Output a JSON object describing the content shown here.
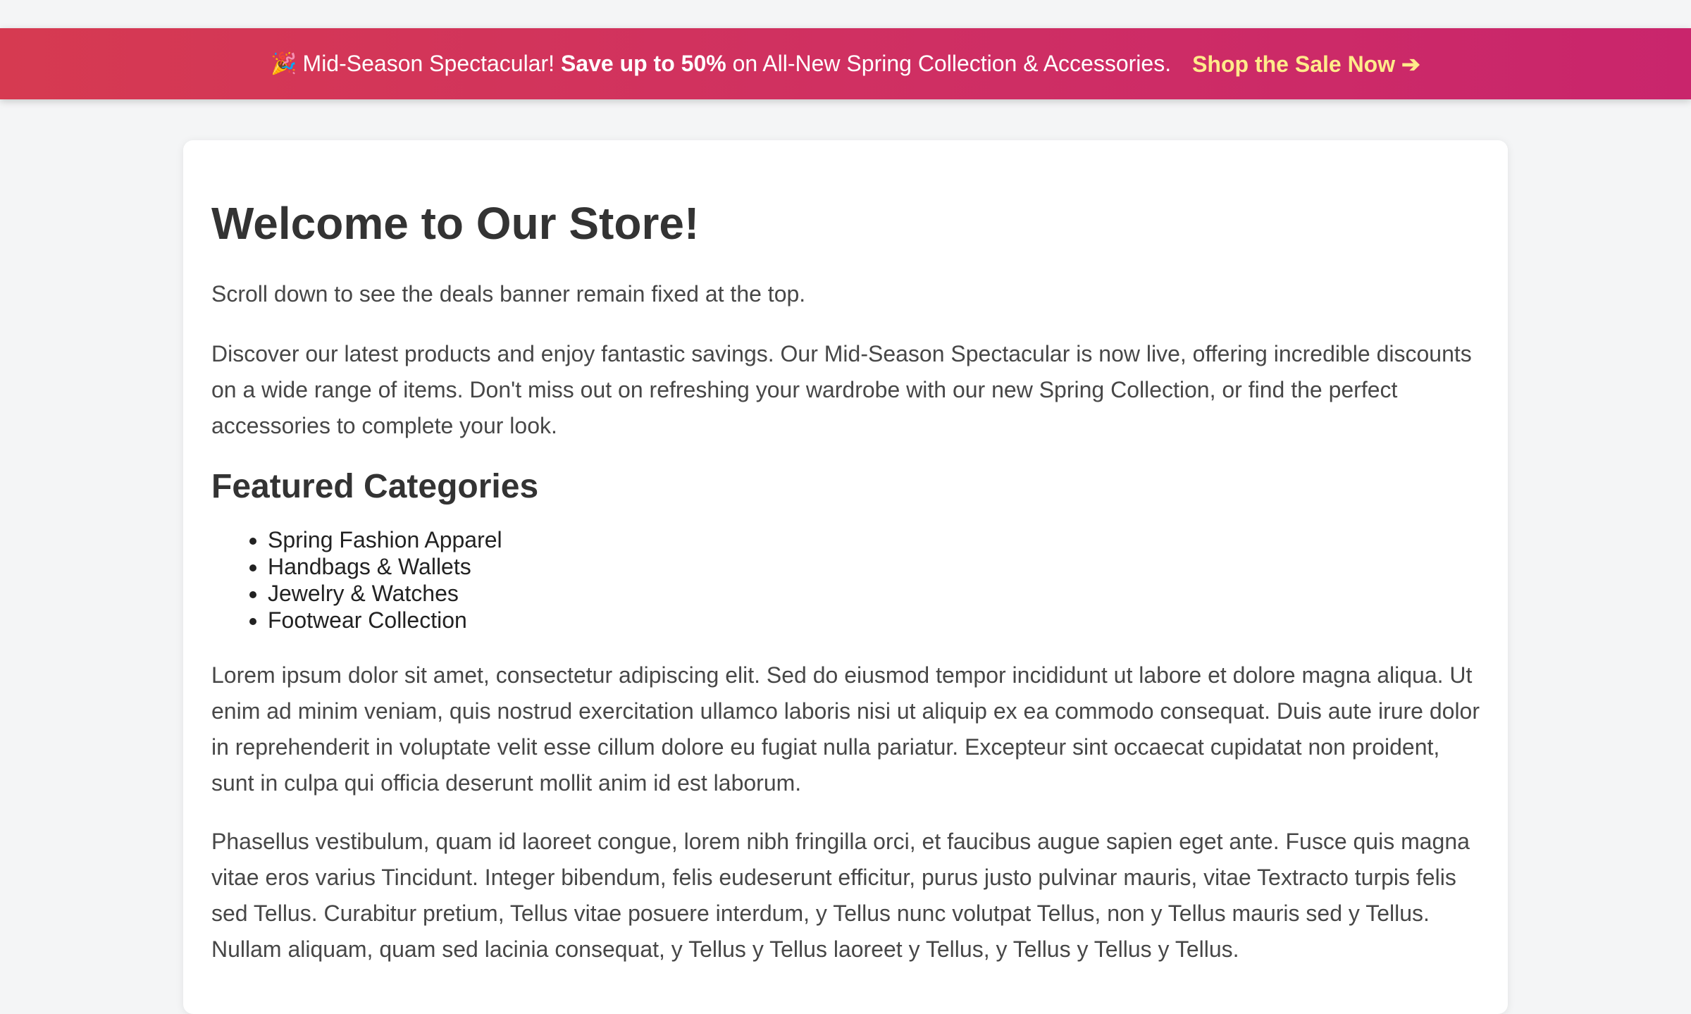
{
  "banner": {
    "emoji": "🎉",
    "text_before": "Mid-Season Spectacular!",
    "text_bold": "Save up to 50%",
    "text_after": "on All-New Spring Collection & Accessories.",
    "cta_label": "Shop the Sale Now ➔"
  },
  "main": {
    "title": "Welcome to Our Store!",
    "intro": "Scroll down to see the deals banner remain fixed at the top.",
    "description": "Discover our latest products and enjoy fantastic savings. Our Mid-Season Spectacular is now live, offering incredible discounts on a wide range of items. Don't miss out on refreshing your wardrobe with our new Spring Collection, or find the perfect accessories to complete your look.",
    "categories_heading": "Featured Categories",
    "categories": [
      "Spring Fashion Apparel",
      "Handbags & Wallets",
      "Jewelry & Watches",
      "Footwear Collection"
    ],
    "lorem_1": "Lorem ipsum dolor sit amet, consectetur adipiscing elit. Sed do eiusmod tempor incididunt ut labore et dolore magna aliqua. Ut enim ad minim veniam, quis nostrud exercitation ullamco laboris nisi ut aliquip ex ea commodo consequat. Duis aute irure dolor in reprehenderit in voluptate velit esse cillum dolore eu fugiat nulla pariatur. Excepteur sint occaecat cupidatat non proident, sunt in culpa qui officia deserunt mollit anim id est laborum.",
    "lorem_2": "Phasellus vestibulum, quam id laoreet congue, lorem nibh fringilla orci, et faucibus augue sapien eget ante. Fusce quis magna vitae eros varius Tincidunt. Integer bibendum, felis eudeserunt efficitur, purus justo pulvinar mauris, vitae Textracto turpis felis sed Tellus. Curabitur pretium, Tellus vitae posuere interdum, y Tellus nunc volutpat Tellus, non y Tellus mauris sed y Tellus. Nullam aliquam, quam sed lacinia consequat, y Tellus y Tellus laoreet y Tellus, y Tellus y Tellus y Tellus."
  },
  "colors": {
    "banner_start": "#d63a51",
    "banner_end": "#c9256c",
    "cta": "#ffeb8a",
    "page_bg": "#f4f5f6"
  }
}
